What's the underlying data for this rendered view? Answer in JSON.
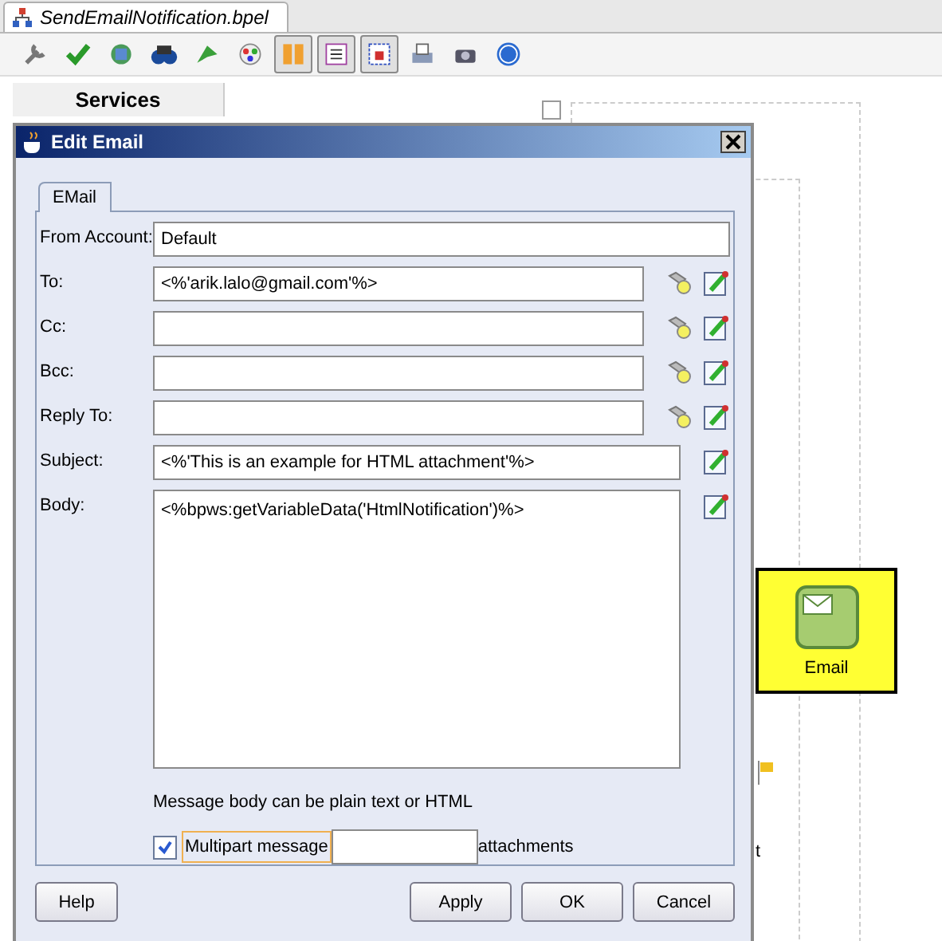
{
  "editor_tab": {
    "title": "SendEmailNotification.bpel"
  },
  "toolbar": [
    {
      "pressed": false
    },
    {
      "pressed": false
    },
    {
      "pressed": false
    },
    {
      "pressed": false
    },
    {
      "pressed": false
    },
    {
      "pressed": false
    },
    {
      "pressed": true
    },
    {
      "pressed": true
    },
    {
      "pressed": true
    },
    {
      "pressed": false
    },
    {
      "pressed": false
    },
    {
      "pressed": false
    }
  ],
  "services_panel": {
    "title": "Services"
  },
  "canvas": {
    "node": {
      "label": "Email"
    },
    "label_fragment": "t"
  },
  "dialog": {
    "title": "Edit Email",
    "tabs": [
      {
        "label": "EMail",
        "selected": true
      }
    ],
    "fields": [
      {
        "label": "From Account:",
        "value": "Default",
        "kind": "plain"
      },
      {
        "label": "To:",
        "value": "<%'arik.lalo@gmail.com'%>",
        "kind": "lookup"
      },
      {
        "label": "Cc:",
        "kind": "lookup"
      },
      {
        "label": "Bcc:",
        "kind": "lookup"
      },
      {
        "label": "Reply To:",
        "kind": "lookup"
      },
      {
        "label": "Subject:",
        "value": "<%'This is an example for HTML attachment'%>",
        "kind": "expression"
      },
      {
        "label": "Body:",
        "value": "<%bpws:getVariableData('HtmlNotification')%>",
        "kind": "multiline"
      }
    ],
    "hint": "Message body can be plain text or HTML",
    "multipart": {
      "label": "Multipart message",
      "checked": true,
      "suffix": "attachments"
    },
    "buttons": [
      {
        "label": "Help",
        "kind": "left"
      },
      {
        "label": "Apply",
        "kind": "right"
      },
      {
        "label": "OK",
        "kind": "right"
      },
      {
        "label": "Cancel",
        "kind": "right"
      }
    ]
  }
}
